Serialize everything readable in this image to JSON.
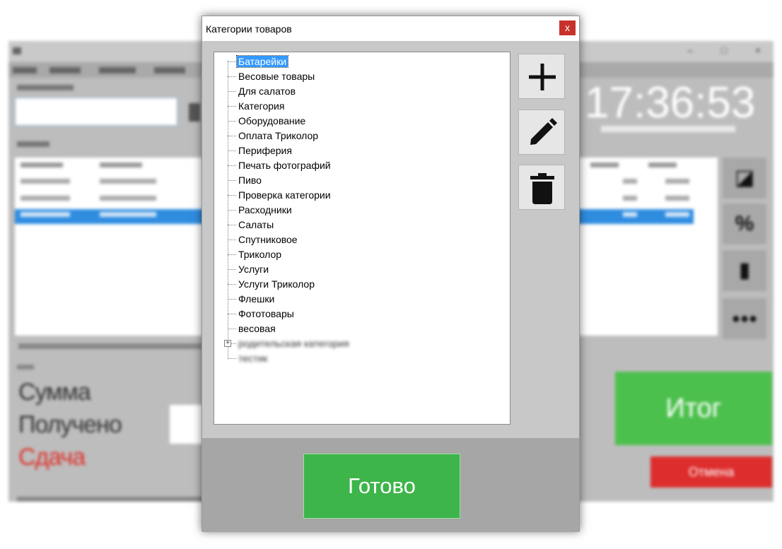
{
  "dialog": {
    "title": "Категории товаров",
    "close_label": "x",
    "done_label": "Готово",
    "tools": [
      {
        "name": "add-button",
        "icon": "plus-icon"
      },
      {
        "name": "edit-button",
        "icon": "pencil-icon"
      },
      {
        "name": "delete-button",
        "icon": "trash-icon"
      }
    ],
    "categories": [
      "Батарейки",
      "Весовые товары",
      "Для салатов",
      "Категория",
      "Оборудование",
      "Оплата Триколор",
      "Периферия",
      "Печать фотографий",
      "Пиво",
      "Проверка категории",
      "Расходники",
      "Салаты",
      "Спутниковое",
      "Триколор",
      "Услуги",
      "Услуги Триколор",
      "Флешки",
      "Фототовары",
      "весовая"
    ],
    "selected_index": 0,
    "blurred_nodes": [
      "родительская категория",
      "тестик"
    ],
    "selection_color": "#3399ff",
    "done_color": "#3db54a"
  },
  "background": {
    "clock": "17:36:53",
    "sum_label": "Сумма",
    "received_label": "Получено",
    "change_label": "Сдача",
    "total_button": "Итог",
    "cancel_button": "Отмена",
    "total_color": "#4cc04c",
    "cancel_color": "#dd2d2d",
    "change_color": "#e0302a"
  }
}
